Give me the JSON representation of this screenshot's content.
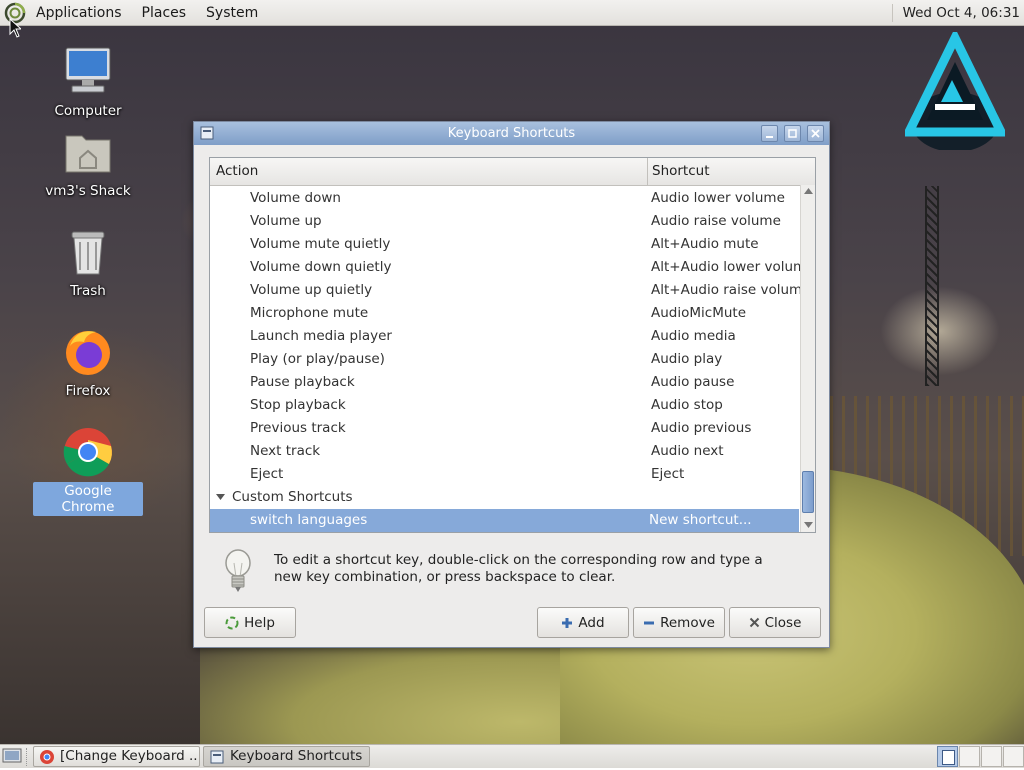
{
  "top_panel": {
    "menus": [
      "Applications",
      "Places",
      "System"
    ],
    "clock": "Wed Oct  4, 06:31"
  },
  "desktop": {
    "icons": [
      {
        "label": "Computer",
        "icon": "computer-icon"
      },
      {
        "label": "vm3's Shack",
        "icon": "home-folder-icon"
      },
      {
        "label": "Trash",
        "icon": "trash-icon"
      },
      {
        "label": "Firefox",
        "icon": "firefox-icon"
      },
      {
        "label": "Google Chrome",
        "icon": "chrome-icon",
        "selected": true
      }
    ]
  },
  "window": {
    "title": "Keyboard Shortcuts",
    "columns": {
      "action": "Action",
      "shortcut": "Shortcut"
    },
    "rows": [
      {
        "action": "Volume down",
        "shortcut": "Audio lower volume"
      },
      {
        "action": "Volume up",
        "shortcut": "Audio raise volume"
      },
      {
        "action": "Volume mute quietly",
        "shortcut": "Alt+Audio mute"
      },
      {
        "action": "Volume down quietly",
        "shortcut": "Alt+Audio lower volume"
      },
      {
        "action": "Volume up quietly",
        "shortcut": "Alt+Audio raise volume"
      },
      {
        "action": "Microphone mute",
        "shortcut": "AudioMicMute"
      },
      {
        "action": "Launch media player",
        "shortcut": "Audio media"
      },
      {
        "action": "Play (or play/pause)",
        "shortcut": "Audio play"
      },
      {
        "action": "Pause playback",
        "shortcut": "Audio pause"
      },
      {
        "action": "Stop playback",
        "shortcut": "Audio stop"
      },
      {
        "action": "Previous track",
        "shortcut": "Audio previous"
      },
      {
        "action": "Next track",
        "shortcut": "Audio next"
      },
      {
        "action": "Eject",
        "shortcut": "Eject"
      }
    ],
    "group": {
      "label": "Custom Shortcuts",
      "expanded": true
    },
    "custom_rows": [
      {
        "action": "switch languages",
        "shortcut": "New shortcut...",
        "selected": true
      }
    ],
    "hint": "To edit a shortcut key, double-click on the corresponding row and type a new key combination, or press backspace to clear.",
    "buttons": {
      "help": "Help",
      "add": "Add",
      "remove": "Remove",
      "close": "Close"
    }
  },
  "taskbar": {
    "tasks": [
      {
        "label": "[Change Keyboard ...",
        "icon": "chrome-icon",
        "active": false
      },
      {
        "label": "Keyboard Shortcuts",
        "icon": "keyboard-shortcuts-icon",
        "active": true
      }
    ],
    "workspaces": 4,
    "current_workspace": 1
  },
  "colors": {
    "selection": "#86a9d9",
    "titlebar": "#7f9ec8",
    "panel": "#e3e1dd"
  }
}
